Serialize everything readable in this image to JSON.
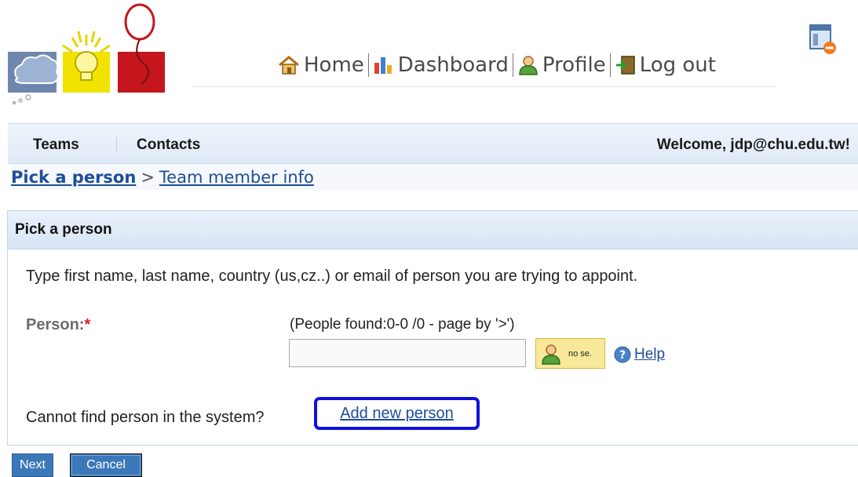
{
  "nav": {
    "home": "Home",
    "dashboard": "Dashboard",
    "profile": "Profile",
    "logout": "Log out"
  },
  "menu": {
    "teams": "Teams",
    "contacts": "Contacts",
    "welcome": "Welcome, jdp@chu.edu.tw!"
  },
  "breadcrumb": {
    "current": "Pick a person",
    "separator": ">",
    "next": "Team member info"
  },
  "panel": {
    "title": "Pick a person",
    "instructions": "Type first name, last name, country (us,cz..) or email of person you are trying to appoint.",
    "person_label": "Person:",
    "required_mark": "*",
    "found_info": "(People found:0-0 /0 - page by '>')",
    "person_value": "",
    "search_button": "no se.",
    "help": "Help",
    "cannot_find": "Cannot find person in the system?",
    "add_new": "Add new person"
  },
  "buttons": {
    "next": "Next",
    "cancel": "Cancel"
  },
  "colors": {
    "link": "#1f4e96",
    "highlight_border": "#1010e0",
    "button": "#3a78b8",
    "required": "#d42020"
  },
  "icons": [
    "cloud-logo-icon",
    "lightbulb-logo-icon",
    "balloon-logo-icon",
    "home-icon",
    "dashboard-icon",
    "profile-icon",
    "logout-icon",
    "window-remove-icon",
    "person-search-icon",
    "help-icon"
  ]
}
